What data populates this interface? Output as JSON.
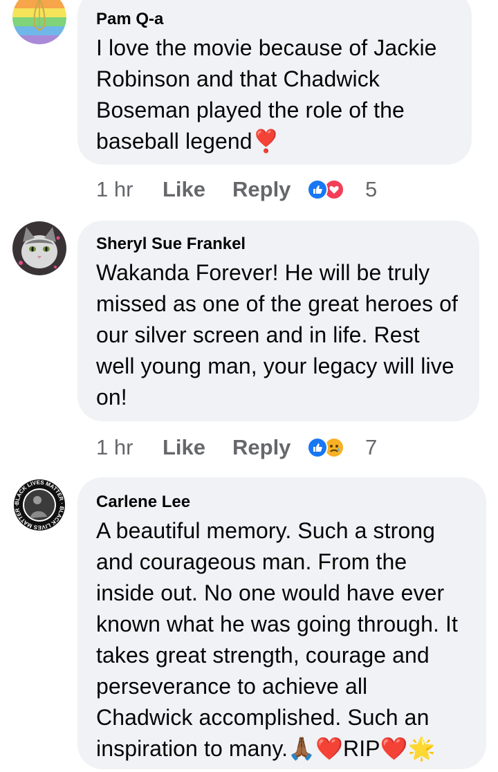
{
  "comments": [
    {
      "author": "Pam Q-a",
      "text": "I love the movie because of Jackie Robinson and that Chadwick Boseman played the role of the baseball legend❣️",
      "time": "1 hr",
      "like_label": "Like",
      "reply_label": "Reply",
      "reactions": [
        "like",
        "love"
      ],
      "reaction_count": "5"
    },
    {
      "author": "Sheryl Sue Frankel",
      "text": "Wakanda Forever!  He will be truly missed as one of the great heroes of our silver screen and in life. Rest well young man, your legacy will live on!",
      "time": "1 hr",
      "like_label": "Like",
      "reply_label": "Reply",
      "reactions": [
        "like",
        "sad"
      ],
      "reaction_count": "7"
    },
    {
      "author": "Carlene Lee",
      "text": "A beautiful memory. Such a strong and courageous man. From the inside out. No one would have ever known what he was going through. It takes great strength, courage and perseverance to achieve all Chadwick accomplished. Such an inspiration to many.🙏🏾❤️RIP❤️🌟"
    }
  ],
  "avatar3_ring_text": "BLACK LIVES MATTER · BLACK LIVES MATTER ·",
  "colors": {
    "bubble": "#f0f2f5",
    "secondary_text": "#65676b",
    "like_blue": "#1877f2",
    "love_red": "#f33e58",
    "sad_yellow": "#f7b125"
  }
}
